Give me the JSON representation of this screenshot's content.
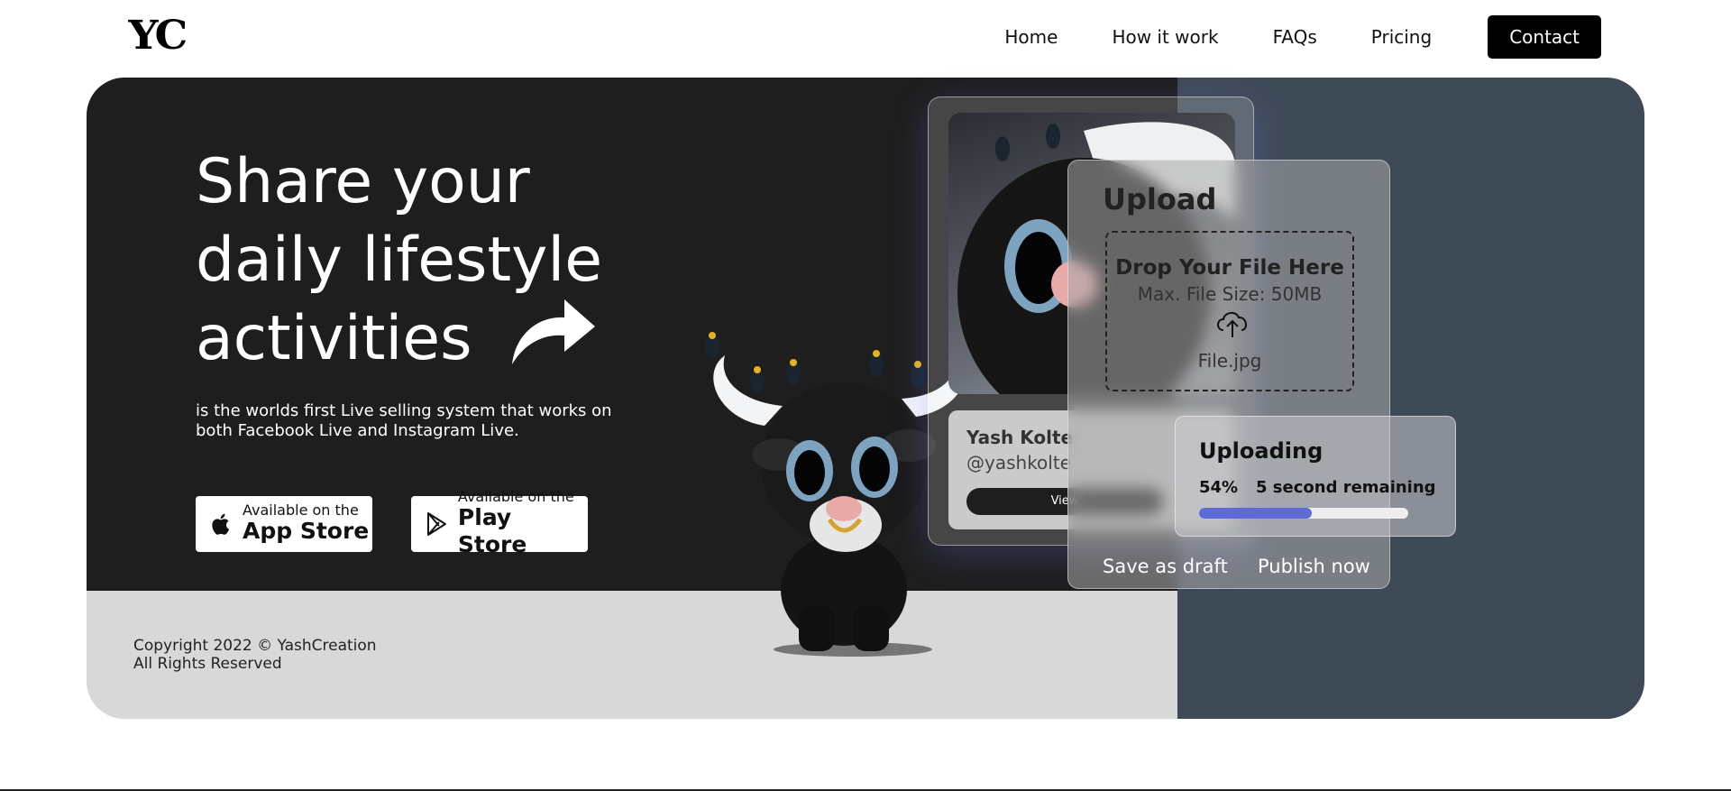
{
  "header": {
    "logo": "YC",
    "nav": [
      "Home",
      "How it work",
      "FAQs",
      "Pricing"
    ],
    "contact": "Contact"
  },
  "hero": {
    "headline_line1": "Share your",
    "headline_line2": "daily lifestyle",
    "headline_line3": "activities",
    "description": "is the worlds first Live selling system that works on both Facebook Live and Instagram Live.",
    "app_store": {
      "small": "Available on the",
      "big": "App Store",
      "icon": "apple-icon"
    },
    "play_store": {
      "small": "Available on the",
      "big": "Play Store",
      "icon": "play-store-icon"
    }
  },
  "footer": {
    "copyright": "Copyright 2022 © YashCreation",
    "rights": "All Rights Reserved"
  },
  "profile": {
    "name": "Yash Kolte",
    "handle": "@yashkolte",
    "view": "View"
  },
  "upload": {
    "title": "Upload",
    "drop_title": "Drop Your File Here",
    "drop_sub": "Max. File Size: 50MB",
    "file_name": "File.jpg",
    "save_draft": "Save as draft",
    "publish": "Publish now"
  },
  "uploading": {
    "title": "Uploading",
    "percent_label": "54%",
    "percent_value": 0.54,
    "remaining": "5 second remaining"
  },
  "colors": {
    "hero_dark": "#1e1e1e",
    "hero_grey": "#d8d8d8",
    "hero_slate": "#3f4a57",
    "progress": "#5c6bd6"
  }
}
